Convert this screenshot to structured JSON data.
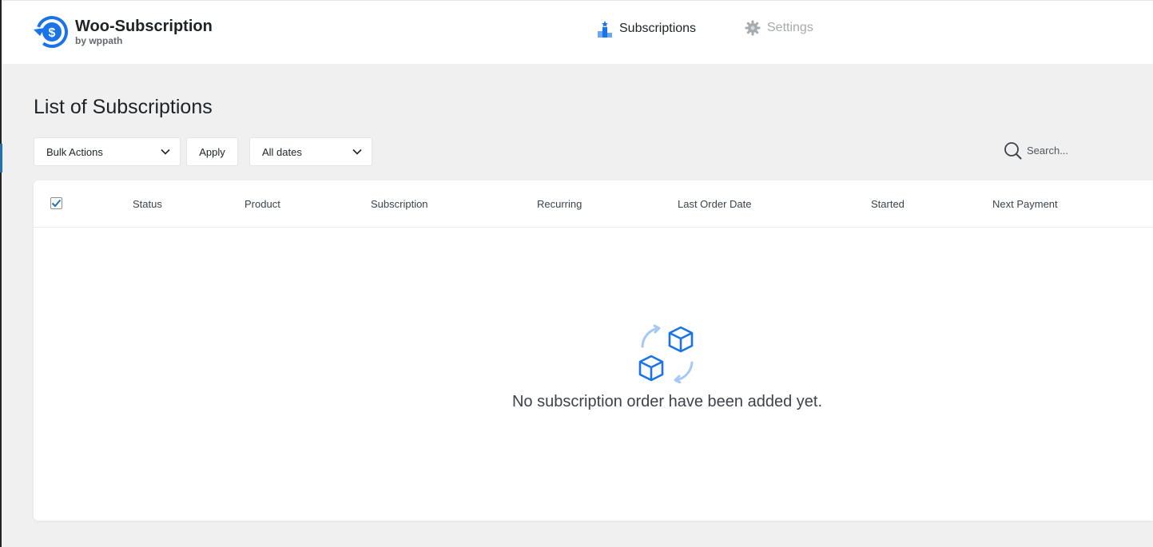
{
  "brand": {
    "title": "Woo-Subscription",
    "subtitle": "by wppath"
  },
  "nav": {
    "subscriptions": "Subscriptions",
    "settings": "Settings"
  },
  "page": {
    "title": "List of Subscriptions"
  },
  "filters": {
    "bulk_actions": "Bulk Actions",
    "apply": "Apply",
    "all_dates": "All dates"
  },
  "search": {
    "placeholder": "Search..."
  },
  "table": {
    "columns": [
      "Status",
      "Product",
      "Subscription",
      "Recurring",
      "Last Order Date",
      "Started",
      "Next Payment"
    ],
    "select_all_checked": true
  },
  "empty_state": {
    "message": "No subscription order have been added yet."
  },
  "colors": {
    "accent": "#1a73e8",
    "accent_light": "#a6c8f5",
    "muted": "#a7aaad"
  },
  "icons": {
    "brand": "dollar-refresh-icon",
    "subscriptions": "podium-icon",
    "settings": "gear-icon",
    "search": "search-icon",
    "dropdown": "chevron-down-icon",
    "empty": "boxes-cycle-icon"
  }
}
